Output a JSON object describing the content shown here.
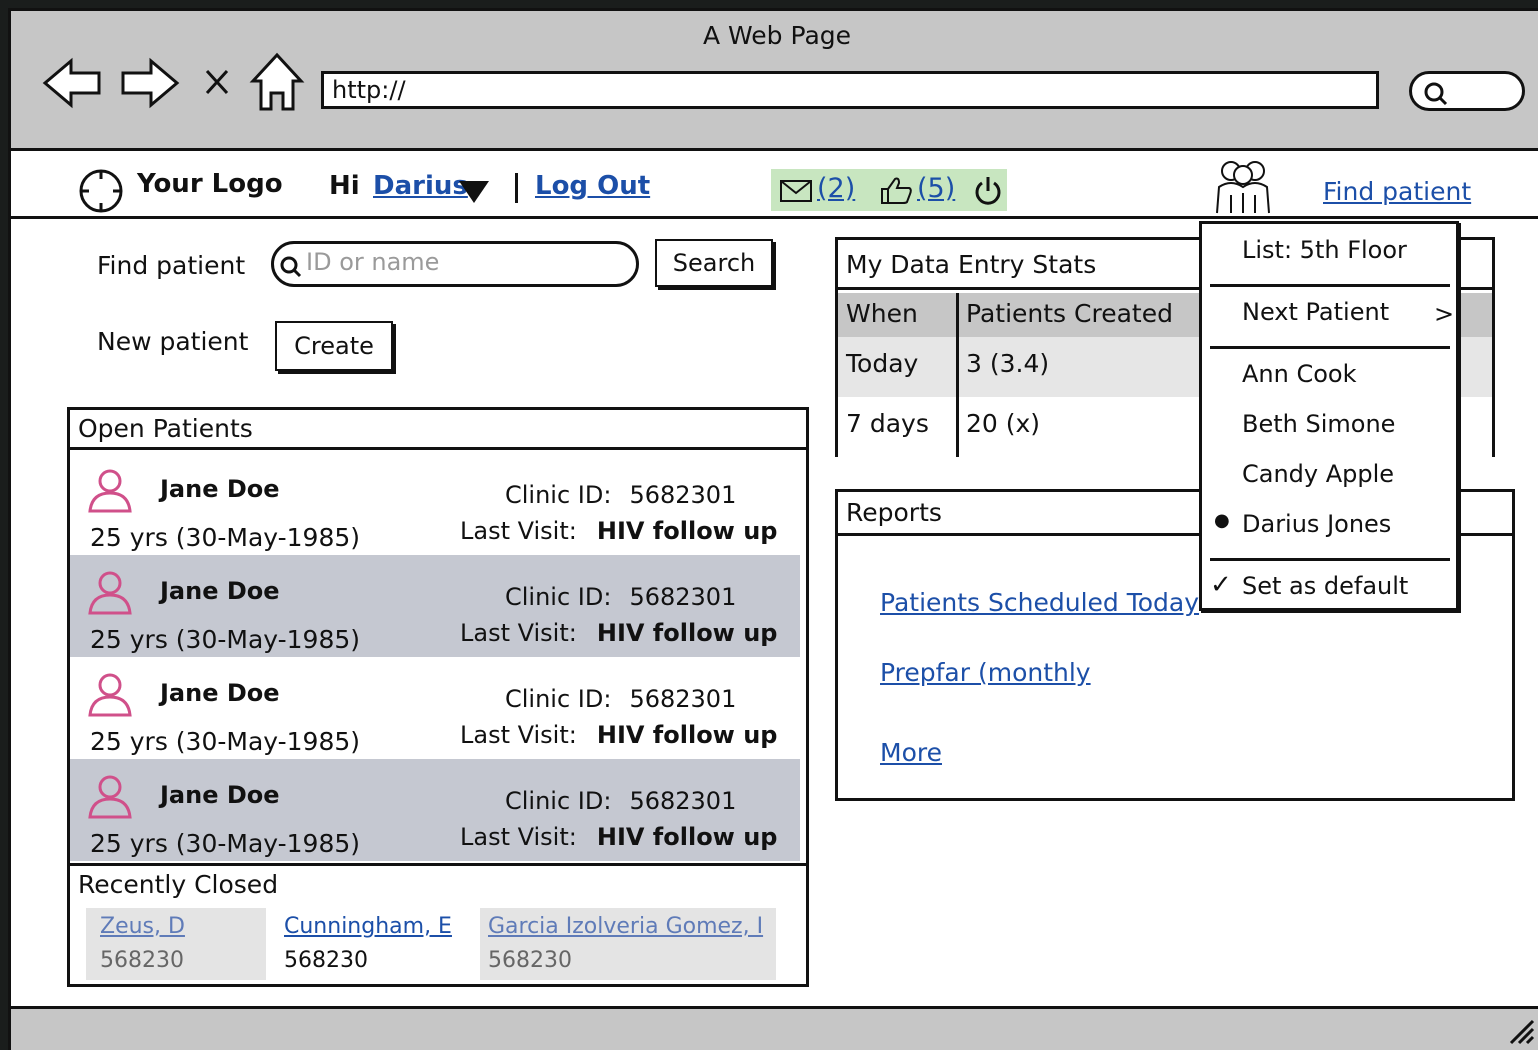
{
  "window": {
    "title": "A Web Page",
    "url": "http://"
  },
  "header": {
    "logo_text": "Your Logo",
    "greeting": "Hi",
    "user": "Darius",
    "logout": "Log Out",
    "messages_count": "(2)",
    "likes_count": "(5)",
    "find_patient": "Find patient",
    "notify_bg": "#c8e6c0"
  },
  "search": {
    "label": "Find patient",
    "placeholder": "ID or name",
    "button": "Search",
    "new_label": "New patient",
    "create_button": "Create"
  },
  "open_patients": {
    "title": "Open Patients",
    "rows": [
      {
        "name": "Jane Doe",
        "age": "25 yrs (30-May-1985)",
        "clinic_label": "Clinic ID:",
        "clinic_id": "5682301",
        "visit_label": "Last Visit:",
        "visit": "HIV follow up"
      },
      {
        "name": "Jane Doe",
        "age": "25 yrs (30-May-1985)",
        "clinic_label": "Clinic ID:",
        "clinic_id": "5682301",
        "visit_label": "Last Visit:",
        "visit": "HIV follow up"
      },
      {
        "name": "Jane Doe",
        "age": "25 yrs (30-May-1985)",
        "clinic_label": "Clinic ID:",
        "clinic_id": "5682301",
        "visit_label": "Last Visit:",
        "visit": "HIV follow up"
      },
      {
        "name": "Jane Doe",
        "age": "25 yrs (30-May-1985)",
        "clinic_label": "Clinic ID:",
        "clinic_id": "5682301",
        "visit_label": "Last Visit:",
        "visit": "HIV follow up"
      }
    ]
  },
  "recently_closed": {
    "title": "Recently Closed",
    "items": [
      {
        "name": "Zeus, D",
        "id": "568230"
      },
      {
        "name": "Cunningham, E",
        "id": "568230"
      },
      {
        "name": "Garcia Izolveria Gomez, I",
        "id": "568230"
      }
    ]
  },
  "stats": {
    "title": "My Data Entry Stats",
    "headers": [
      "When",
      "Patients Created"
    ],
    "rows": [
      [
        "Today",
        "3 (3.4)"
      ],
      [
        "7 days",
        "20 (x)"
      ]
    ]
  },
  "reports": {
    "title": "Reports",
    "links": [
      "Patients Scheduled Today",
      "Prepfar (monthly",
      "More"
    ]
  },
  "dropdown": {
    "list_label": "List: 5th Floor",
    "next_patient": "Next Patient",
    "patients": [
      "Ann Cook",
      "Beth Simone",
      "Candy Apple",
      "Darius Jones"
    ],
    "selected_bullet": "●",
    "set_default": "Set as default",
    "check": "✓",
    "chevron": ">"
  }
}
